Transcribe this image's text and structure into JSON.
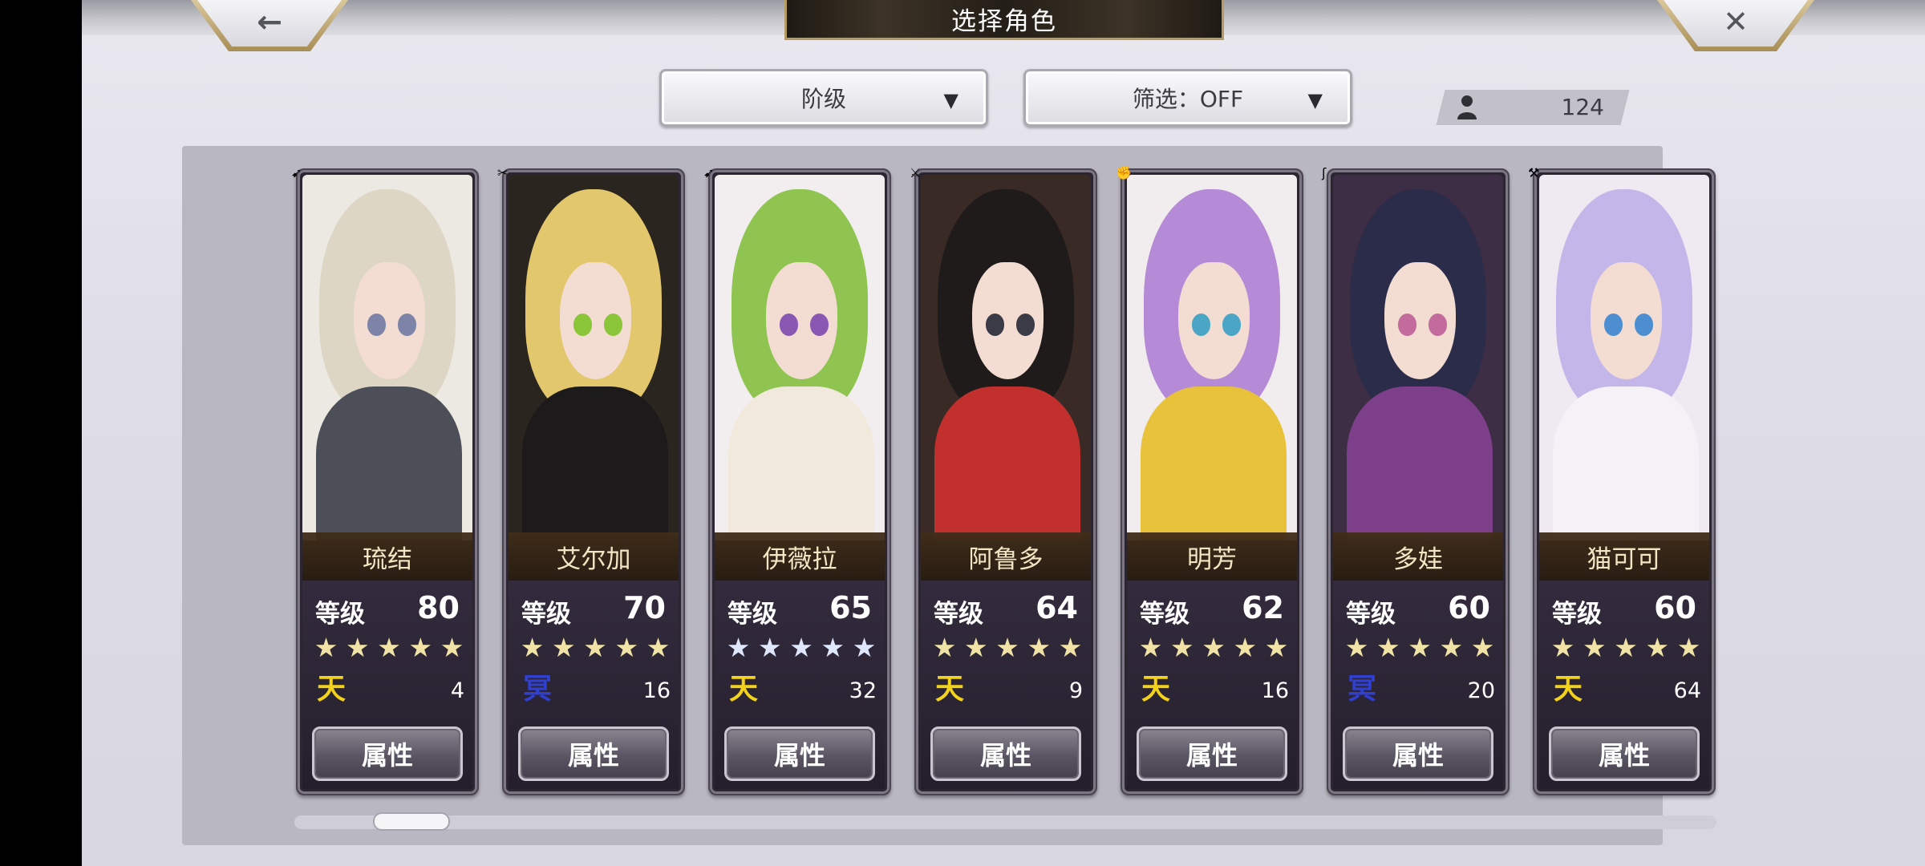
{
  "title": "选择角色",
  "nav": {
    "back_icon": "←",
    "close_icon": "✕"
  },
  "sort_dropdown": {
    "label": "阶级",
    "caret": "▼"
  },
  "filter_dropdown": {
    "label": "筛选：OFF",
    "caret": "▼"
  },
  "roster_count": "124",
  "level_label": "等级",
  "attr_label": "属性",
  "characters": [
    {
      "name": "琉结",
      "level": "80",
      "stars": "★★★★★",
      "star_color": "#f1e3a6",
      "emblem": "天",
      "emblem_color": "#f2d21a",
      "number": "4",
      "weapon_icon": "➹",
      "palette": {
        "bg": "#ece8e2",
        "hair": "#ddd6c4",
        "body": "#4c4f58",
        "eye": "#7d84a8"
      }
    },
    {
      "name": "艾尔加",
      "level": "70",
      "stars": "★★★★★",
      "star_color": "#f1e3a6",
      "emblem": "冥",
      "emblem_color": "#2f3fd0",
      "number": "16",
      "weapon_icon": "✂",
      "palette": {
        "bg": "#2b2520",
        "hair": "#e3c76c",
        "body": "#1c1a1a",
        "eye": "#8ac53a"
      }
    },
    {
      "name": "伊薇拉",
      "level": "65",
      "stars": "★★★★★",
      "star_color": "#dfe7ff",
      "emblem": "天",
      "emblem_color": "#f2d21a",
      "number": "32",
      "weapon_icon": "➹",
      "palette": {
        "bg": "#f2eef0",
        "hair": "#8fc451",
        "body": "#f1eadc",
        "eye": "#8a58b3"
      }
    },
    {
      "name": "阿鲁多",
      "level": "64",
      "stars": "★★★★★",
      "star_color": "#f1e3a6",
      "emblem": "天",
      "emblem_color": "#f2d21a",
      "number": "9",
      "weapon_icon": "⚔",
      "palette": {
        "bg": "#3a2a26",
        "hair": "#1f1b1b",
        "body": "#c2302d",
        "eye": "#3b3b48"
      }
    },
    {
      "name": "明芳",
      "level": "62",
      "stars": "★★★★★",
      "star_color": "#f1e3a6",
      "emblem": "天",
      "emblem_color": "#f2d21a",
      "number": "16",
      "weapon_icon": "✊",
      "palette": {
        "bg": "#f1ecee",
        "hair": "#b58ad6",
        "body": "#e9c23c",
        "eye": "#4aa6c4"
      }
    },
    {
      "name": "多娃",
      "level": "60",
      "stars": "★★★★★",
      "star_color": "#f1e3a6",
      "emblem": "冥",
      "emblem_color": "#2f3fd0",
      "number": "20",
      "weapon_icon": "ʃ",
      "palette": {
        "bg": "#3d2e45",
        "hair": "#2a2c49",
        "body": "#7d3e8a",
        "eye": "#c26b9c"
      }
    },
    {
      "name": "猫可可",
      "level": "60",
      "stars": "★★★★★",
      "star_color": "#f1e3a6",
      "emblem": "天",
      "emblem_color": "#f2d21a",
      "number": "64",
      "weapon_icon": "⚒",
      "palette": {
        "bg": "#efeaf2",
        "hair": "#c5b6e9",
        "body": "#f4f1f7",
        "eye": "#4d8ed1"
      }
    }
  ]
}
